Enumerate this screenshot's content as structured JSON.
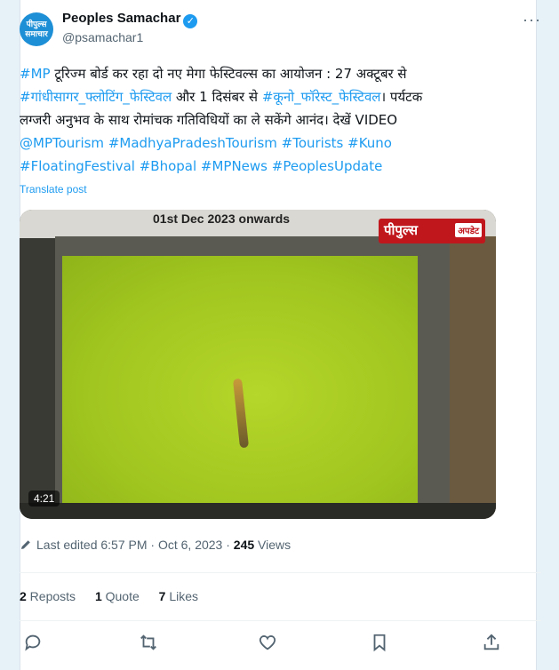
{
  "author": {
    "name": "Peoples Samachar",
    "handle": "@psamachar1",
    "avatar_text": "पीपुल्स\nसमाचार"
  },
  "tweet": {
    "line1_tag": "#MP",
    "line1_text": " टूरिज्म बोर्ड कर रहा दो नए मेगा फेस्टिवल्स का आयोजन : 27 अक्टूबर से",
    "line2_tag": "#गांधीसागर_फ्लोटिंग_फेस्टिवल",
    "line2_text": " और 1 दिसंबर से ",
    "line2_tag2": "#कूनो_फॉरेस्ट_फेस्टिवल",
    "line2_end": "। पर्यटक",
    "line3_text": "लग्जरी अनुभव के साथ रोमांचक गतिविधियों का ले सकेंगे आनंद। देखें VIDEO",
    "line4_tags": "@MPTourism #MadhyaPradeshTourism #Tourists #Kuno",
    "line5_tags": "#FloatingFestival #Bhopal #MPNews #PeoplesUpdate"
  },
  "translate_label": "Translate post",
  "media": {
    "banner_text": "01st Dec 2023 onwards",
    "logo_main": "पीपुल्स",
    "logo_sub": "अपडेट",
    "duration": "4:21"
  },
  "meta": {
    "edited_text": "Last edited 6:57 PM · Oct 6, 2023 · ",
    "views_count": "245",
    "views_label": " Views"
  },
  "stats": {
    "reposts_count": "2",
    "reposts_label": " Reposts",
    "quotes_count": "1",
    "quotes_label": " Quote",
    "likes_count": "7",
    "likes_label": " Likes"
  },
  "icons": {
    "verified": "verified-badge-icon",
    "more": "more-options-icon",
    "reply": "reply-icon",
    "repost": "repost-icon",
    "like": "like-icon",
    "bookmark": "bookmark-icon",
    "share": "share-icon"
  },
  "colors": {
    "link": "#1d9bf0",
    "text": "#0f1419",
    "secondary": "#536471",
    "brand_red": "#c0171d"
  }
}
